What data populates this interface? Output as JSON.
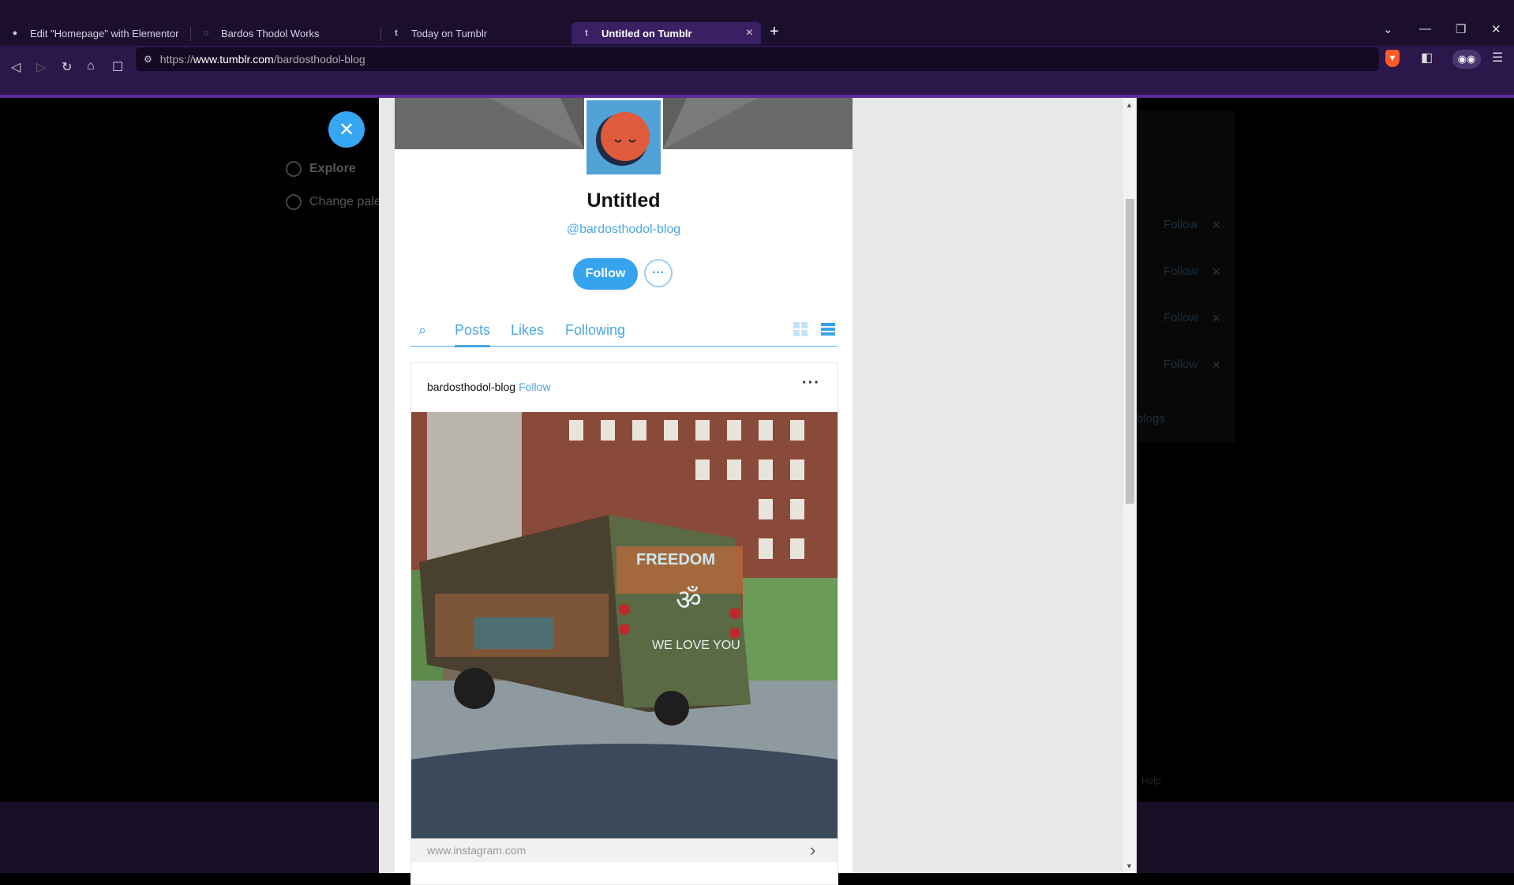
{
  "browser": {
    "tabs": [
      {
        "title": "Edit \"Homepage\" with Elementor",
        "icon": "wordpress-icon"
      },
      {
        "title": "Bardos Thodol Works",
        "icon": "globe-icon"
      },
      {
        "title": "Today on Tumblr",
        "icon": "tumblr-icon"
      },
      {
        "title": "Untitled on Tumblr",
        "icon": "tumblr-icon",
        "active": true
      }
    ],
    "url_prefix": "https://",
    "url_host": "www.tumblr.com",
    "url_path": "/bardosthodol-blog"
  },
  "background": {
    "nav_items": [
      "Explore",
      "Change pale"
    ],
    "follow_label": "Follow",
    "blogs_label": "blogs",
    "help_label": "Help"
  },
  "blog": {
    "title": "Untitled",
    "handle": "@bardosthodol-blog",
    "follow_label": "Follow",
    "more_label": "···",
    "tabs": [
      "Posts",
      "Likes",
      "Following"
    ]
  },
  "post": {
    "username": "bardosthodol-blog",
    "follow_label": "Follow",
    "more_label": "···",
    "image_text_top": "FREEDOM",
    "image_text_om": "ॐ",
    "image_text_bottom": "WE LOVE YOU",
    "source": "www.instagram.com"
  },
  "colors": {
    "accent": "#36a3ef",
    "tab_active": "#3a1f63",
    "toolbar": "#2b174a"
  }
}
